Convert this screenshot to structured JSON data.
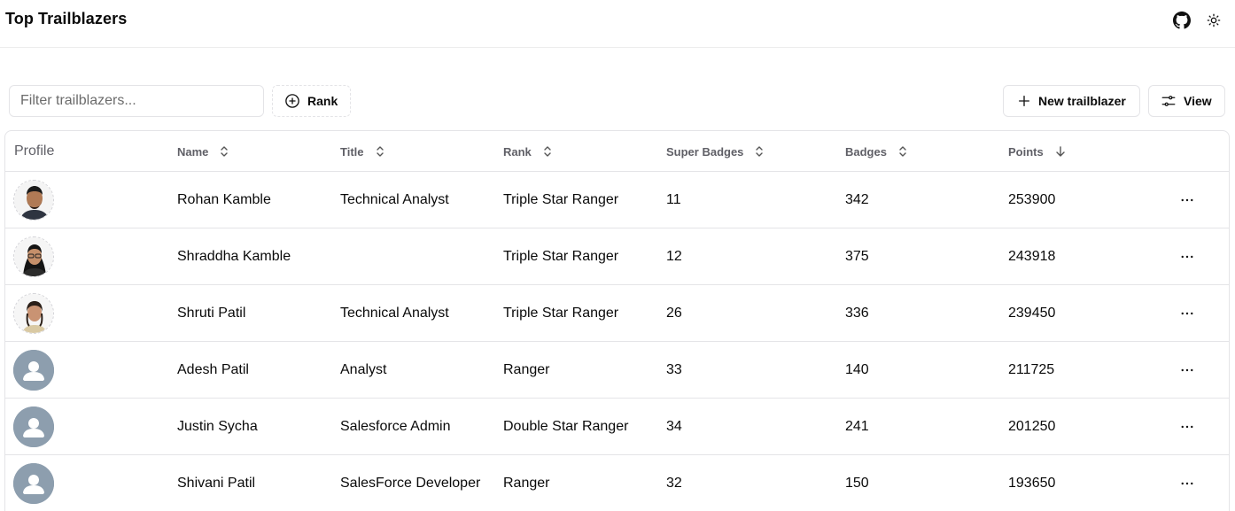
{
  "header": {
    "title": "Top Trailblazers",
    "icons": [
      "github-icon",
      "sun-icon"
    ]
  },
  "toolbar": {
    "filter_placeholder": "Filter trailblazers...",
    "filter_value": "",
    "rank_label": "Rank",
    "new_label": "New trailblazer",
    "view_label": "View"
  },
  "table": {
    "headers": {
      "profile": "Profile",
      "name": "Name",
      "title": "Title",
      "rank": "Rank",
      "super_badges": "Super Badges",
      "badges": "Badges",
      "points": "Points"
    },
    "rows": [
      {
        "avatar": "photo-man-beard",
        "name": "Rohan Kamble",
        "title": "Technical Analyst",
        "rank": "Triple Star Ranger",
        "super_badges": "11",
        "badges": "342",
        "points": "253900"
      },
      {
        "avatar": "photo-woman-glasses",
        "name": "Shraddha Kamble",
        "title": "",
        "rank": "Triple Star Ranger",
        "super_badges": "12",
        "badges": "375",
        "points": "243918"
      },
      {
        "avatar": "photo-woman",
        "name": "Shruti Patil",
        "title": "Technical Analyst",
        "rank": "Triple Star Ranger",
        "super_badges": "26",
        "badges": "336",
        "points": "239450"
      },
      {
        "avatar": "default-user-icon",
        "name": "Adesh Patil",
        "title": "Analyst",
        "rank": "Ranger",
        "super_badges": "33",
        "badges": "140",
        "points": "211725"
      },
      {
        "avatar": "default-user-icon",
        "name": "Justin Sycha",
        "title": "Salesforce Admin",
        "rank": "Double Star Ranger",
        "super_badges": "34",
        "badges": "241",
        "points": "201250"
      },
      {
        "avatar": "default-user-icon",
        "name": "Shivani Patil",
        "title": "SalesForce Developer",
        "rank": "Ranger",
        "super_badges": "32",
        "badges": "150",
        "points": "193650"
      }
    ]
  }
}
